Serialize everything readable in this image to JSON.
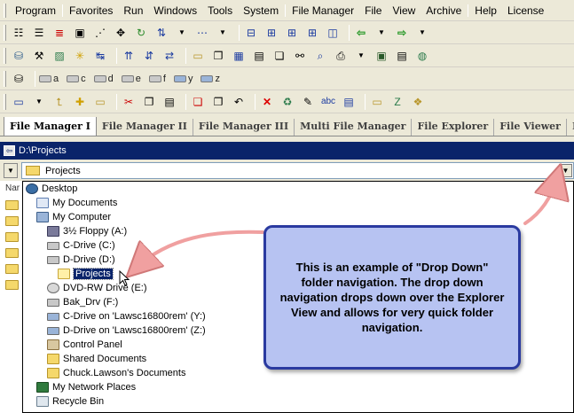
{
  "menubar": {
    "items": [
      "Program",
      "Favorites",
      "Run",
      "Windows",
      "Tools",
      "System",
      "File Manager",
      "File",
      "View",
      "Archive",
      "Help",
      "License"
    ]
  },
  "toolbar3": {
    "drives": [
      "a",
      "c",
      "d",
      "e",
      "f",
      "y",
      "z"
    ]
  },
  "tabs": [
    "File Manager I",
    "File Manager II",
    "File Manager III",
    "Multi File Manager",
    "File Explorer",
    "File Viewer",
    "Folder Inform"
  ],
  "path_bar": {
    "path": "D:\\Projects"
  },
  "combo": {
    "value": "Projects"
  },
  "left_pane": {
    "header": "Nar"
  },
  "tree": [
    {
      "label": "Desktop",
      "icon": "desktop-icon"
    },
    {
      "label": "My Documents",
      "icon": "documents-icon"
    },
    {
      "label": "My Computer",
      "icon": "computer-icon"
    },
    {
      "label": "3½ Floppy (A:)",
      "icon": "floppy-icon"
    },
    {
      "label": "C-Drive (C:)",
      "icon": "drive-icon"
    },
    {
      "label": "D-Drive (D:)",
      "icon": "drive-icon"
    },
    {
      "label": "Projects",
      "icon": "open-folder-icon",
      "selected": true
    },
    {
      "label": "DVD-RW Drive (E:)",
      "icon": "dvd-icon"
    },
    {
      "label": "Bak_Drv (F:)",
      "icon": "drive-icon"
    },
    {
      "label": "C-Drive on 'Lawsc16800rem' (Y:)",
      "icon": "network-drive-icon"
    },
    {
      "label": "D-Drive on 'Lawsc16800rem' (Z:)",
      "icon": "network-drive-icon"
    },
    {
      "label": "Control Panel",
      "icon": "control-panel-icon"
    },
    {
      "label": "Shared Documents",
      "icon": "folder-icon"
    },
    {
      "label": "Chuck.Lawson's Documents",
      "icon": "folder-icon"
    },
    {
      "label": "My Network Places",
      "icon": "network-icon"
    },
    {
      "label": "Recycle Bin",
      "icon": "recycle-bin-icon"
    }
  ],
  "callout": {
    "text": "This is an example of \"Drop Down\" folder navigation.  The drop down navigation drops down over the Explorer View and allows for very quick folder navigation."
  },
  "colors": {
    "path_bar_bg": "#0a246a",
    "selection": "#0a246a",
    "callout_fill": "#b7c3f2",
    "callout_border": "#2a3aa0",
    "arrow": "#f0a0a0"
  }
}
